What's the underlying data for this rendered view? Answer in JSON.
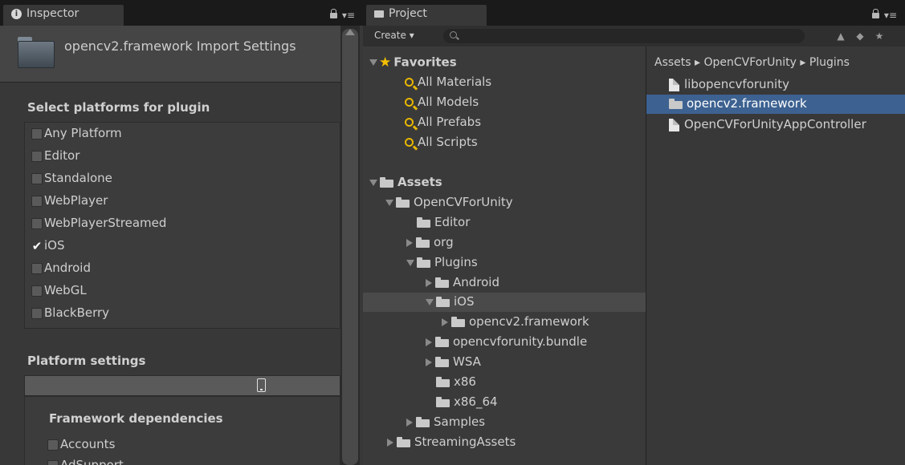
{
  "inspector": {
    "tab_label": "Inspector",
    "title": "opencv2.framework Import Settings",
    "select_platforms_title": "Select platforms for plugin",
    "platforms": [
      {
        "label": "Any Platform",
        "checked": false
      },
      {
        "label": "Editor",
        "checked": false
      },
      {
        "label": "Standalone",
        "checked": false
      },
      {
        "label": "WebPlayer",
        "checked": false
      },
      {
        "label": "WebPlayerStreamed",
        "checked": false
      },
      {
        "label": "iOS",
        "checked": true
      },
      {
        "label": "Android",
        "checked": false
      },
      {
        "label": "WebGL",
        "checked": false
      },
      {
        "label": "BlackBerry",
        "checked": false
      }
    ],
    "platform_settings_title": "Platform settings",
    "framework_dependencies_title": "Framework dependencies",
    "dependencies": [
      {
        "label": "Accounts",
        "checked": false
      },
      {
        "label": "AdSupport",
        "checked": false
      }
    ]
  },
  "project": {
    "tab_label": "Project",
    "create_label": "Create ▾",
    "favorites": {
      "label": "Favorites",
      "items": [
        "All Materials",
        "All Models",
        "All Prefabs",
        "All Scripts"
      ]
    },
    "tree": [
      {
        "label": "Assets",
        "expanded": "open",
        "bold": true
      },
      {
        "label": "OpenCVForUnity",
        "expanded": "open"
      },
      {
        "label": "Editor",
        "expanded": "none"
      },
      {
        "label": "org",
        "expanded": "closed"
      },
      {
        "label": "Plugins",
        "expanded": "open"
      },
      {
        "label": "Android",
        "expanded": "closed"
      },
      {
        "label": "iOS",
        "expanded": "open",
        "highlighted": true
      },
      {
        "label": "opencv2.framework",
        "expanded": "closed"
      },
      {
        "label": "opencvforunity.bundle",
        "expanded": "closed"
      },
      {
        "label": "WSA",
        "expanded": "closed"
      },
      {
        "label": "x86",
        "expanded": "none"
      },
      {
        "label": "x86_64",
        "expanded": "none"
      },
      {
        "label": "Samples",
        "expanded": "closed"
      },
      {
        "label": "StreamingAssets",
        "expanded": "closed"
      }
    ],
    "breadcrumb": "Assets ▸ OpenCVForUnity ▸ Plugins",
    "files": [
      {
        "label": "libopencvforunity",
        "type": "file",
        "selected": false
      },
      {
        "label": "opencv2.framework",
        "type": "folder",
        "selected": true
      },
      {
        "label": "OpenCVForUnityAppController",
        "type": "file",
        "selected": false
      }
    ]
  }
}
